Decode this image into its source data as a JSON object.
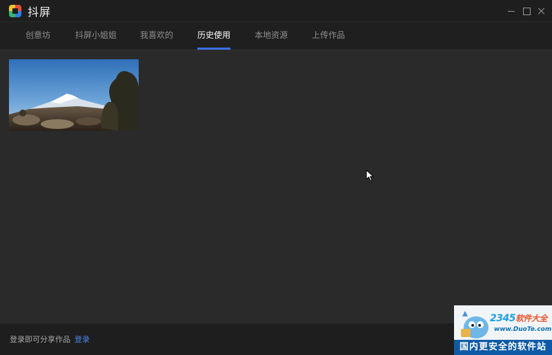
{
  "window": {
    "title": "抖屏",
    "logo_icon": "app-logo-icon"
  },
  "tabs": [
    {
      "label": "创意坊",
      "active": false
    },
    {
      "label": "抖屏小姐姐",
      "active": false
    },
    {
      "label": "我喜欢的",
      "active": false
    },
    {
      "label": "历史使用",
      "active": true
    },
    {
      "label": "本地资源",
      "active": false
    },
    {
      "label": "上传作品",
      "active": false
    }
  ],
  "history": {
    "items": [
      {
        "type": "wallpaper",
        "icon": "mountain-landscape-thumbnail"
      }
    ]
  },
  "footer": {
    "prompt_text": "登录即可分享作品",
    "login_label": "登录"
  },
  "watermark": {
    "brand_numbers": "2345",
    "brand_cn": "软件大全",
    "url": "www.DuoTe.com",
    "banner": "国内更安全的软件站"
  },
  "colors": {
    "accent": "#3b6fe6",
    "background": "#2a2a2a",
    "titlebar": "#1e1e1e",
    "link": "#4a86f0"
  }
}
